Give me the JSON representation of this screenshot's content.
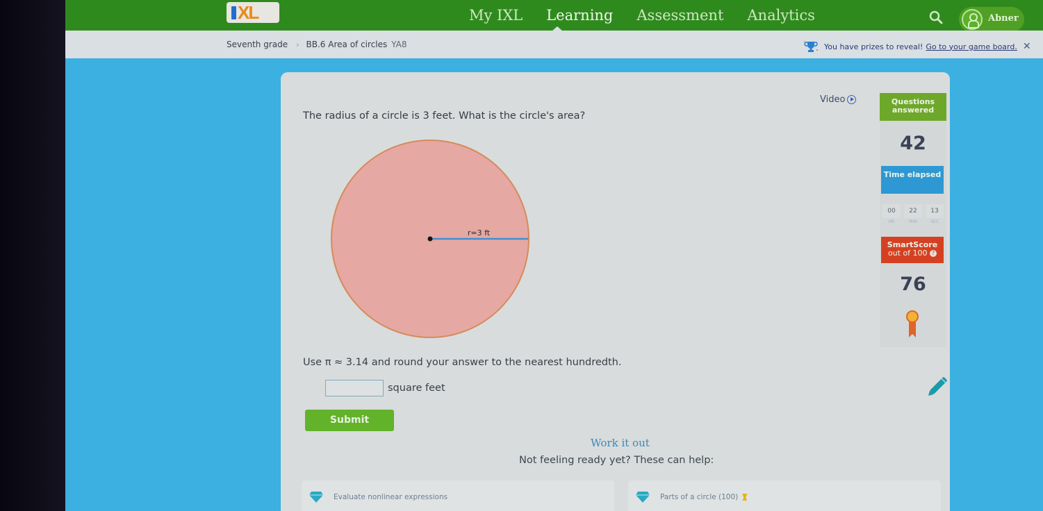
{
  "nav": {
    "logo_text": "XL",
    "links": [
      {
        "label": "My IXL",
        "active": false
      },
      {
        "label": "Learning",
        "active": true
      },
      {
        "label": "Assessment",
        "active": false
      },
      {
        "label": "Analytics",
        "active": false
      }
    ],
    "search_icon": "search-icon",
    "user": {
      "name": "Abner",
      "icon": "user-avatar-icon"
    }
  },
  "breadcrumb": {
    "grade": "Seventh grade",
    "separator": "›",
    "skill": "BB.6 Area of circles",
    "code": "YA8"
  },
  "prize_banner": {
    "icon": "trophy-icon",
    "text": "You have prizes to reveal!",
    "link": "Go to your game board.",
    "close": "✕"
  },
  "question": {
    "text": "The radius of a circle is 3 feet. What is the circle's area?",
    "video_label": "Video",
    "figure": {
      "radius_label": "r=3 ft",
      "fill_color": "#e6a8a3",
      "stroke_color": "#d68a5a",
      "radius_color": "#3d8fd6"
    },
    "instructions": "Use π ≈ 3.14 and round your answer to the nearest hundredth.",
    "answer_value": "",
    "answer_unit": "square feet",
    "submit_label": "Submit"
  },
  "help": {
    "work_it_out": "Work it out",
    "not_ready": "Not feeling ready yet? These can help:",
    "cards": [
      {
        "label": "Evaluate nonlinear expressions",
        "icon": "gem-icon"
      },
      {
        "label": "Parts of a circle (100)",
        "icon": "gem-icon",
        "medal": true
      }
    ]
  },
  "stats": {
    "questions_answered_label": "Questions answered",
    "questions_answered": "42",
    "time_elapsed_label": "Time elapsed",
    "time": {
      "hr": "00",
      "min": "22",
      "sec": "13",
      "hr_label": "HR",
      "min_label": "MIN",
      "sec_label": "SEC"
    },
    "smartscore_label": "SmartScore",
    "smartscore_sub": "out of 100",
    "smartscore": "76"
  },
  "colors": {
    "nav_green": "#2f8a1e",
    "background_blue": "#3cb0e0",
    "submit_green": "#62b22a",
    "questions_green": "#6ea82a",
    "time_blue": "#2d98d3",
    "score_red": "#d64022"
  }
}
